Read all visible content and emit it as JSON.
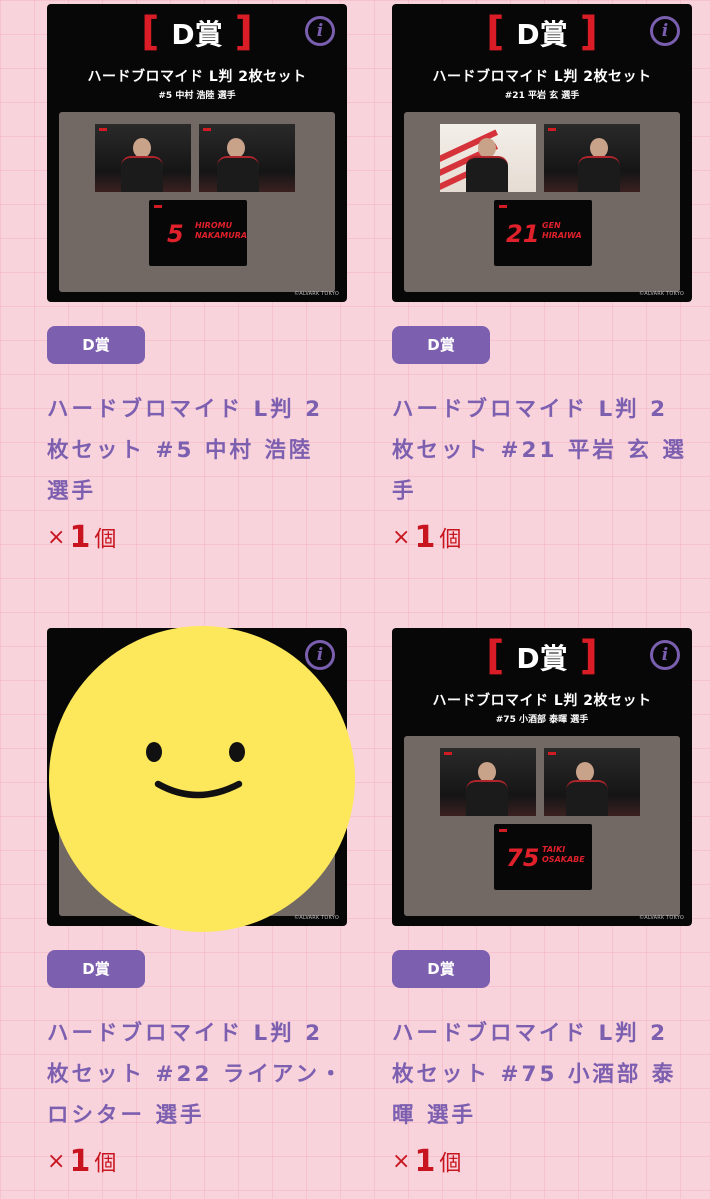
{
  "items": [
    {
      "badge": "D賞",
      "title": "ハードブロマイド L判 2枚セット #5 中村 浩陸 選手",
      "qty_prefix": "×",
      "qty_value": "1",
      "qty_unit": "個",
      "image": {
        "grade": "D賞",
        "title": "ハードブロマイド L判 2枚セット",
        "subtitle": "#5 中村 浩陸 選手",
        "number": "5",
        "name_line1": "HIROMU",
        "name_line2": "NAKAMURA",
        "info_glyph": "i",
        "copyright": "©ALVARK TOKYO"
      }
    },
    {
      "badge": "D賞",
      "title": "ハードブロマイド L判 2枚セット #21 平岩 玄 選手",
      "qty_prefix": "×",
      "qty_value": "1",
      "qty_unit": "個",
      "image": {
        "grade": "D賞",
        "title": "ハードブロマイド L判 2枚セット",
        "subtitle": "#21 平岩 玄 選手",
        "number": "21",
        "name_line1": "GEN",
        "name_line2": "HIRAIWA",
        "info_glyph": "i",
        "copyright": "©ALVARK TOKYO"
      }
    },
    {
      "badge": "D賞",
      "title": "ハードブロマイド L判 2枚セット #22 ライアン・ロシター 選手",
      "qty_prefix": "×",
      "qty_value": "1",
      "qty_unit": "個",
      "image": {
        "info_glyph": "i",
        "copyright": "©ALVARK TOKYO"
      }
    },
    {
      "badge": "D賞",
      "title": "ハードブロマイド L判 2枚セット #75 小酒部 泰暉 選手",
      "qty_prefix": "×",
      "qty_value": "1",
      "qty_unit": "個",
      "image": {
        "grade": "D賞",
        "title": "ハードブロマイド L判 2枚セット",
        "subtitle": "#75 小酒部 泰暉 選手",
        "number": "75",
        "name_line1": "TAIKI",
        "name_line2": "OSAKABE",
        "info_glyph": "i",
        "copyright": "©ALVARK TOKYO"
      }
    }
  ],
  "colors": {
    "accent_purple": "#7d5fb0",
    "quantity_red": "#c8141e",
    "background_pink": "#f9d3dc"
  },
  "overlay": {
    "icon": "smiley-face-icon"
  }
}
